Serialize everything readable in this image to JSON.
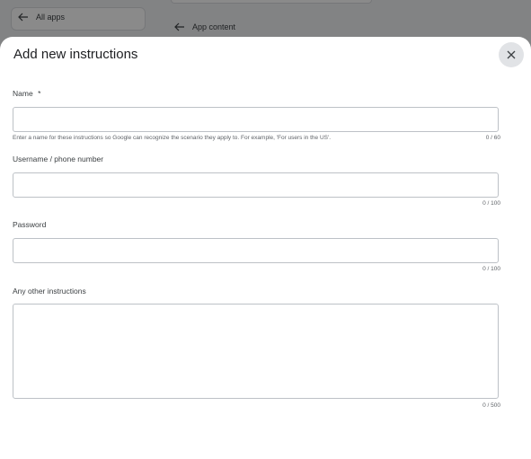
{
  "background": {
    "all_apps_label": "All apps",
    "app_content_label": "App content"
  },
  "dialog": {
    "title": "Add new instructions",
    "close_icon": "close-icon",
    "fields": {
      "name": {
        "label": "Name",
        "required_marker": "*",
        "value": "",
        "hint": "Enter a name for these instructions so Google can recognize the scenario they apply to. For example, 'For users in the US'.",
        "counter": "0 / 60"
      },
      "username": {
        "label": "Username / phone number",
        "value": "",
        "counter": "0 / 100"
      },
      "password": {
        "label": "Password",
        "value": "",
        "counter": "0 / 100"
      },
      "other": {
        "label": "Any other instructions",
        "value": "",
        "counter": "0 / 500"
      }
    }
  },
  "colors": {
    "scrim": "#000000",
    "field_border": "#bdc1c6",
    "close_button_bg": "#e1e3e6"
  }
}
